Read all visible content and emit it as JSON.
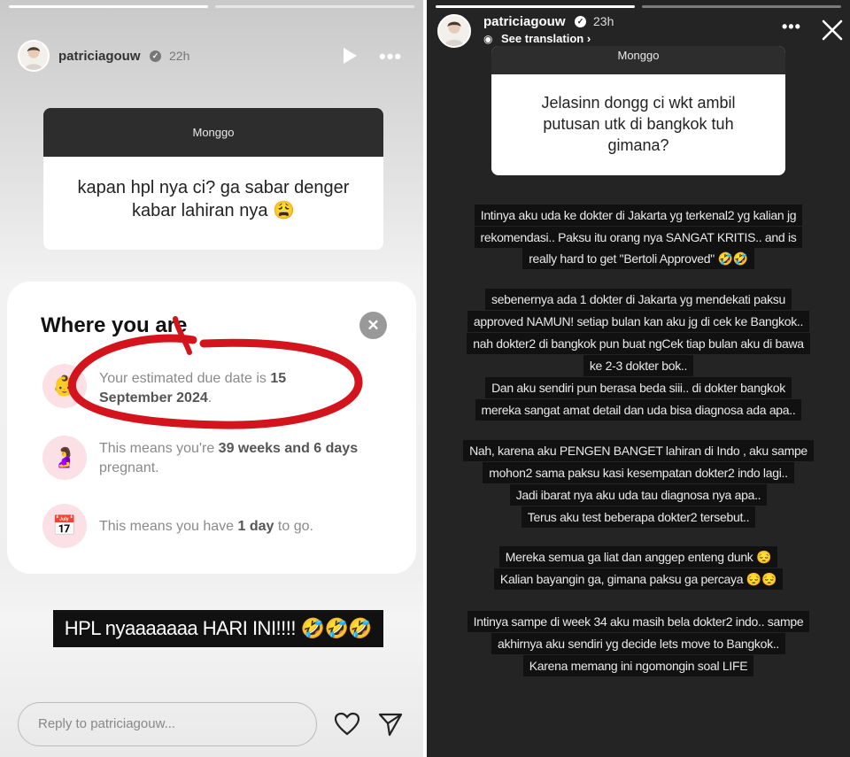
{
  "left": {
    "username": "patriciagouw",
    "time": "22h",
    "question_box": {
      "header": "Monggo",
      "text": "kapan hpl nya ci? ga sabar denger kabar lahiran nya 😩"
    },
    "app_card": {
      "title": "Where you are",
      "rows": [
        {
          "pre": "Your estimated due date is ",
          "bold": "15 September 2024",
          "post": "."
        },
        {
          "pre": "This means you're ",
          "bold": "39 weeks and 6 days",
          "post": " pregnant."
        },
        {
          "pre": "This means you have ",
          "bold": "1 day",
          "post": " to go."
        }
      ]
    },
    "caption": "HPL nyaaaaaaa HARI INI!!!! 🤣🤣🤣",
    "reply_placeholder": "Reply to patriciagouw..."
  },
  "right": {
    "username": "patriciagouw",
    "time": "23h",
    "see_translation": "See translation",
    "question_box": {
      "header": "Monggo",
      "text": "Jelasinn dongg ci wkt ambil putusan utk di bangkok tuh gimana?"
    },
    "lines": [
      "Intinya aku uda ke dokter di Jakarta yg terkenal2 yg kalian jg",
      "rekomendasi.. Paksu itu orang nya SANGAT KRITIS.. and is",
      "really hard to get \"Bertoli Approved\" 🤣🤣",
      "sebenernya ada 1 dokter di Jakarta yg mendekati paksu",
      "approved NAMUN! setiap bulan kan aku jg di cek ke Bangkok..",
      "nah dokter2 di bangkok pun buat ngCek tiap bulan aku di bawa",
      "ke 2-3 dokter bok..",
      "Dan aku sendiri pun berasa beda siii.. di dokter bangkok",
      "mereka sangat amat detail dan uda bisa diagnosa ada apa..",
      "Nah, karena aku PENGEN BANGET lahiran di Indo , aku sampe",
      "mohon2 sama paksu kasi kesempatan dokter2 indo lagi..",
      "Jadi ibarat nya aku uda tau diagnosa nya apa..",
      "Terus aku test beberapa dokter2 tersebut..",
      "Mereka semua ga liat dan anggep enteng dunk 😔",
      "Kalian bayangin ga, gimana paksu ga percaya 😔😔",
      "Intinya sampe di week 34 aku masih bela dokter2 indo.. sampe",
      "akhirnya aku sendiri yg decide lets move to Bangkok..",
      "Karena memang ini ngomongin soal LIFE"
    ]
  },
  "colors": {
    "annotation_red": "#d4141c",
    "pink_bg": "#fbe0e6",
    "badge_blue": "#3897f0"
  }
}
